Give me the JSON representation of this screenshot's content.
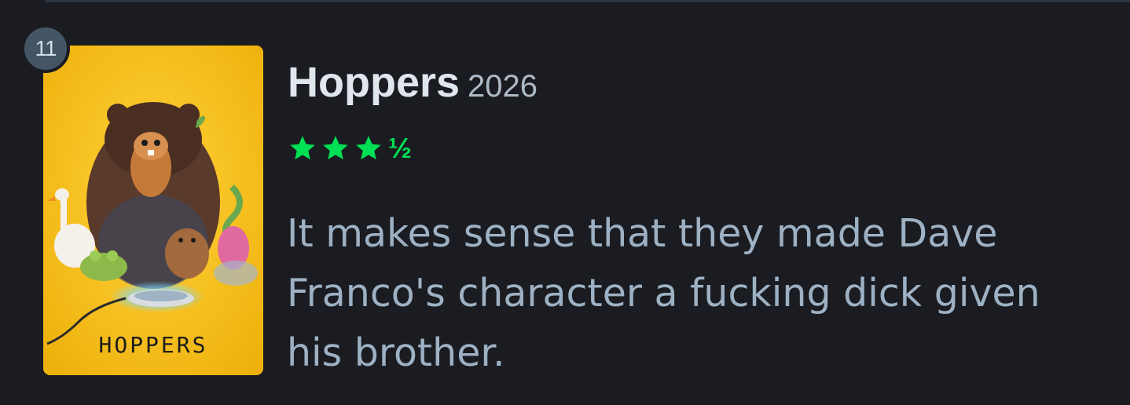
{
  "entry": {
    "rank": "11",
    "title": "Hoppers",
    "year": "2026",
    "rating": {
      "stars": 3.5,
      "out_of": 5,
      "half_glyph": "½",
      "color": "#00e054"
    },
    "review": "It makes sense that they made Dave Franco's character a fucking dick given his brother.",
    "poster": {
      "title_text": "HOPPERS",
      "background_color": "#f4be12"
    }
  }
}
